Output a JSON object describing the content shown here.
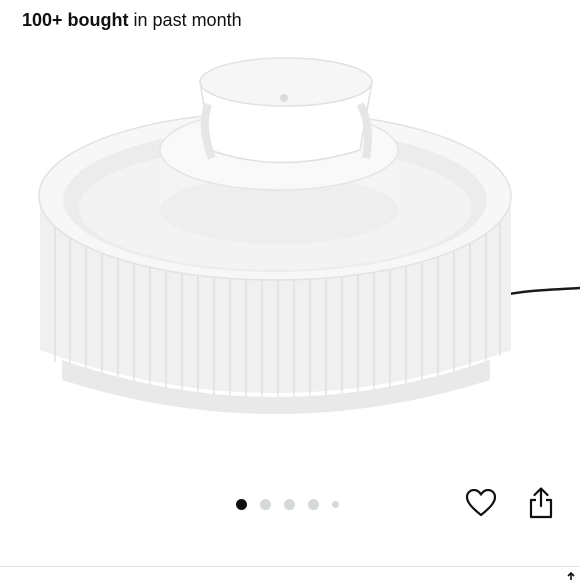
{
  "social_proof": {
    "count_label": "100+ bought",
    "suffix": "in past month"
  },
  "product_image": {
    "icon": "pet-water-fountain-image"
  },
  "carousel": {
    "total_images": 5,
    "active_index": 0
  },
  "actions": {
    "favorite_icon": "heart-outline-icon",
    "share_icon": "share-icon"
  },
  "colors": {
    "text": "#0f1111",
    "dot_active": "#0f1111",
    "dot_inactive": "#d5d9d9",
    "divider": "#e3e6e6"
  }
}
